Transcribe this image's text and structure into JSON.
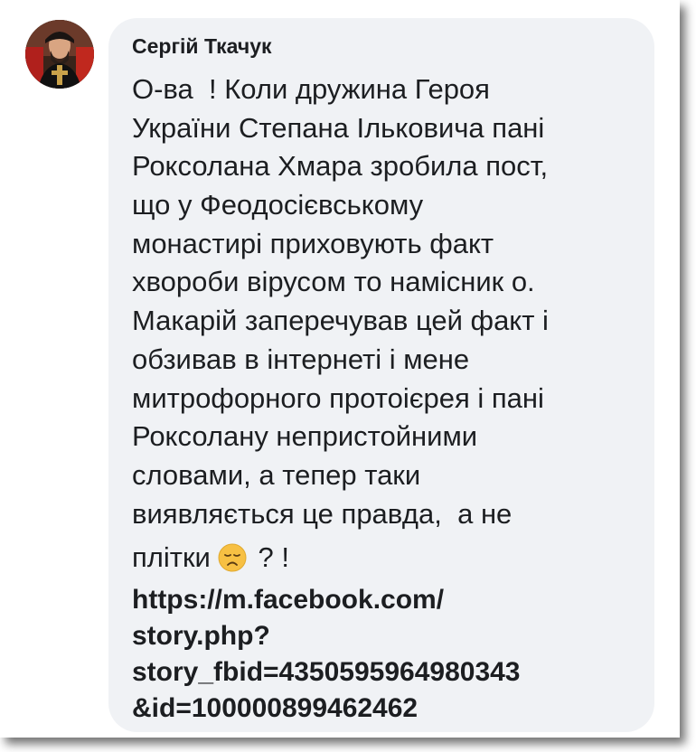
{
  "comment": {
    "author": "Сергій Ткачук",
    "lines": [
      "О-ва  ! Коли дружина Героя",
      "України Степана Ільковича пані",
      "Роксолана Хмара зробила пост,",
      "що у Феодосієвському",
      "монастирі приховують факт",
      "хвороби вірусом то намісник о.",
      "Макарій заперечував цей факт і",
      "обзивав в інтернеті і мене",
      "митрофорного протоієрея і пані",
      "Роксолану непристойними",
      "словами, а тепер таки",
      "виявляється це правда,  а не"
    ],
    "last_line_before_emoji": "плітки",
    "last_line_after_emoji": "? !",
    "emoji_icon": "disappointed-face-icon",
    "link_lines": [
      "https://m.facebook.com/",
      "story.php?",
      "story_fbid=4350595964980343",
      "&id=100000899462462"
    ]
  },
  "colors": {
    "bubble": "#f0f2f5",
    "text": "#1c1e21",
    "emoji": "#f7c043"
  }
}
